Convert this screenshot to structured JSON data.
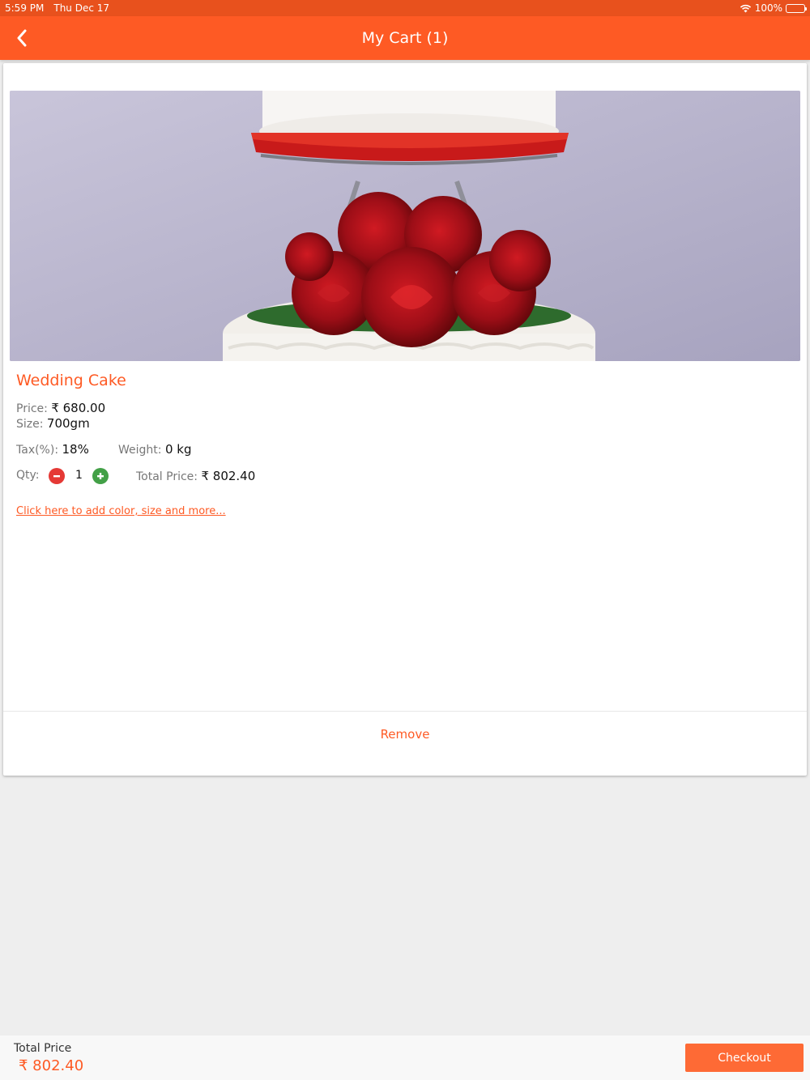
{
  "status_bar": {
    "time": "5:59 PM",
    "date": "Thu Dec 17",
    "battery": "100%"
  },
  "header": {
    "title": "My Cart (1)",
    "back_icon": "chevron-left-icon"
  },
  "cart_item": {
    "name": "Wedding Cake",
    "price_label": "Price:",
    "price_value": "₹ 680.00",
    "size_label": "Size:",
    "size_value": "700gm",
    "tax_label": "Tax(%):",
    "tax_value": "18%",
    "weight_label": "Weight:",
    "weight_value": "0 kg",
    "qty_label": "Qty:",
    "qty_value": "1",
    "total_label": "Total Price:",
    "total_value": "₹ 802.40",
    "customize_link": "Click here to add color, size and more...",
    "remove_label": "Remove"
  },
  "footer": {
    "total_label": "Total Price",
    "total_value": "₹ 802.40",
    "checkout_label": "Checkout"
  },
  "colors": {
    "accent": "#fe5a24",
    "status_bar": "#e8511d",
    "minus": "#e53935",
    "plus": "#43a047"
  }
}
